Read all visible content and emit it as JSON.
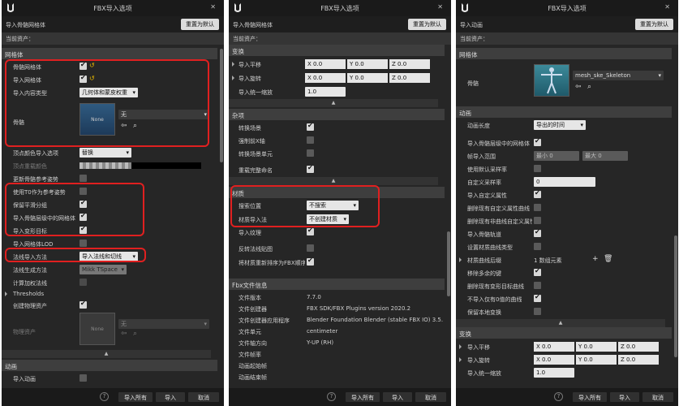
{
  "panel1": {
    "window_title": "FBX导入选项",
    "subtitle": "导入骨骼网格体",
    "reset": "重置为默认",
    "current_asset": "当前资产：",
    "sec_mesh": "网格体",
    "skeletal_mesh": "骨骼网格体",
    "import_mesh": "导入网格体",
    "import_content_type": "导入内容类型",
    "import_content_type_value": "几何体和蒙皮权重",
    "skeleton": "骨骼",
    "skeleton_none": "None",
    "skeleton_value": "无",
    "vertex_color": "顶点颜色导入选项",
    "vertex_color_value": "替换",
    "vertex_override": "顶点重载颜色",
    "update_ref_pose": "更新骨骼参考姿势",
    "use_t0": "使用T0作为参考姿势",
    "keep_smooth": "保留平滑分组",
    "import_mesh_lods": "导入骨骼层级中的网格体",
    "import_morph": "导入变形目标",
    "import_lod": "导入网格体LOD",
    "normal_import": "法线导入方法",
    "normal_import_value": "导入法线和切线",
    "normal_gen": "法线生成方法",
    "normal_gen_value": "Mikk TSpace",
    "compute_weighted": "计算加权法线",
    "thresholds": "Thresholds",
    "create_physics": "创建物理资产",
    "physics_asset": "物理资产",
    "physics_none": "None",
    "physics_value": "无",
    "sec_anim": "动画",
    "import_anim": "导入动画"
  },
  "panel2": {
    "window_title": "FBX导入选项",
    "subtitle": "导入骨骼网格体",
    "reset": "重置为默认",
    "current_asset": "当前资产：",
    "sec_transform": "变换",
    "import_translation": "导入平移",
    "import_rotation": "导入旋转",
    "import_scale": "导入统一缩放",
    "x_label": "X",
    "y_label": "Y",
    "z_label": "Z",
    "zero": "0.0",
    "scale_value": "1.0",
    "sec_misc": "杂项",
    "convert_scene": "转换场景",
    "force_front_x": "强制前X轴",
    "convert_scene_unit": "转换场景单元",
    "reorder_names": "重载完整命名",
    "sec_material": "材质",
    "search_location": "搜索位置",
    "search_location_value": "不搜索",
    "material_import": "材质导入法",
    "material_import_value": "不创建材质",
    "import_textures": "导入纹理",
    "invert_normal": "反转法线贴图",
    "reorder_material": "将材质重新排序为FBX顺序",
    "sec_fbx": "Fbx文件信息",
    "file_version": "文件版本",
    "file_version_value": "7.7.0",
    "file_creator": "文件创建器",
    "file_creator_value": "FBX SDK/FBX Plugins version 2020.2",
    "file_creator_app": "文件创建器应用程序",
    "file_creator_app_value": "Blender Foundation Blender (stable FBX IO) 3.5.1",
    "file_units": "文件单元",
    "file_units_value": "centimeter",
    "file_axis": "文件轴方向",
    "file_axis_value": "Y-UP (RH)",
    "file_framerate": "文件帧率",
    "anim_start": "动画起始帧",
    "anim_end": "动画结束帧"
  },
  "panel3": {
    "window_title": "FBX导入选项",
    "subtitle": "导入动画",
    "reset": "重置为默认",
    "current_asset": "当前资产：",
    "sec_mesh": "网格体",
    "skeleton": "骨骼",
    "skeleton_value": "mesh_ske_Skeleton",
    "sec_anim": "动画",
    "anim_length": "动画长度",
    "anim_length_value": "导出的时间",
    "import_mesh_hierarchy": "导入骨骼层级中的网格体",
    "frame_range": "帧导入范围",
    "min_label": "最小",
    "min_value": "0",
    "max_label": "最大",
    "max_value": "0",
    "use_default_sample": "使用默认采样率",
    "custom_sample": "自定义采样率",
    "custom_sample_value": "0",
    "import_custom_attr": "导入自定义属性",
    "delete_existing_attr": "删除现有自定义属性曲线",
    "delete_existing_non": "删除现有非曲线自定义属性",
    "import_bone_tracks": "导入骨骼轨道",
    "set_material_type": "设置材质曲线类型",
    "material_suffix": "材质曲线后缀",
    "material_suffix_value": "1 数组元素",
    "remove_redundant": "移除多余的键",
    "delete_morph": "删除现有变形目标曲线",
    "import_zero_only": "不导入仅有0值的曲线",
    "preserve_local": "保留本地变换",
    "sec_transform": "变换",
    "import_translation": "导入平移",
    "import_rotation": "导入旋转",
    "import_scale": "导入统一缩放",
    "x_label": "X",
    "y_label": "Y",
    "z_label": "Z",
    "zero": "0.0",
    "scale_value": "1.0"
  },
  "footer": {
    "help": "?",
    "import_all": "导入所有",
    "import": "导入",
    "cancel": "取消"
  }
}
